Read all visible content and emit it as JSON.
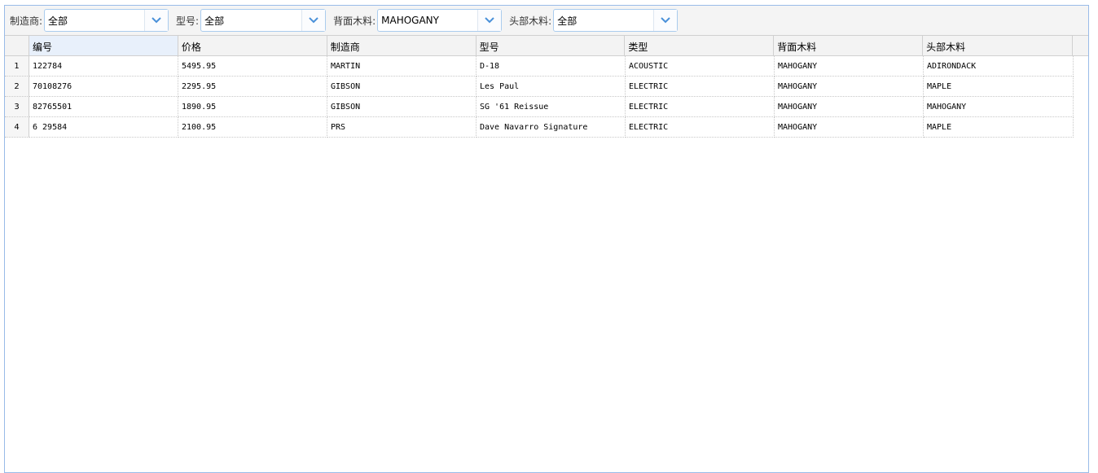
{
  "filters": [
    {
      "label": "制造商:",
      "value": "全部"
    },
    {
      "label": "型号:",
      "value": "全部"
    },
    {
      "label": "背面木料:",
      "value": "MAHOGANY"
    },
    {
      "label": "头部木料:",
      "value": "全部"
    }
  ],
  "columns": [
    "编号",
    "价格",
    "制造商",
    "型号",
    "类型",
    "背面木料",
    "头部木料"
  ],
  "rows": [
    {
      "num": "1",
      "cells": [
        "122784",
        "5495.95",
        "MARTIN",
        "D-18",
        "ACOUSTIC",
        "MAHOGANY",
        "ADIRONDACK"
      ]
    },
    {
      "num": "2",
      "cells": [
        "70108276",
        "2295.95",
        "GIBSON",
        "Les Paul",
        "ELECTRIC",
        "MAHOGANY",
        "MAPLE"
      ]
    },
    {
      "num": "3",
      "cells": [
        "82765501",
        "1890.95",
        "GIBSON",
        "SG '61 Reissue",
        "ELECTRIC",
        "MAHOGANY",
        "MAHOGANY"
      ]
    },
    {
      "num": "4",
      "cells": [
        "6 29584",
        "2100.95",
        "PRS",
        "Dave Navarro Signature",
        "ELECTRIC",
        "MAHOGANY",
        "MAPLE"
      ]
    }
  ],
  "colors": {
    "border": "#99bbe8",
    "combo_border": "#aaccee",
    "trigger_arrow": "#4a90d9"
  },
  "icons": {
    "combo_trigger": "chevron-down-icon"
  }
}
